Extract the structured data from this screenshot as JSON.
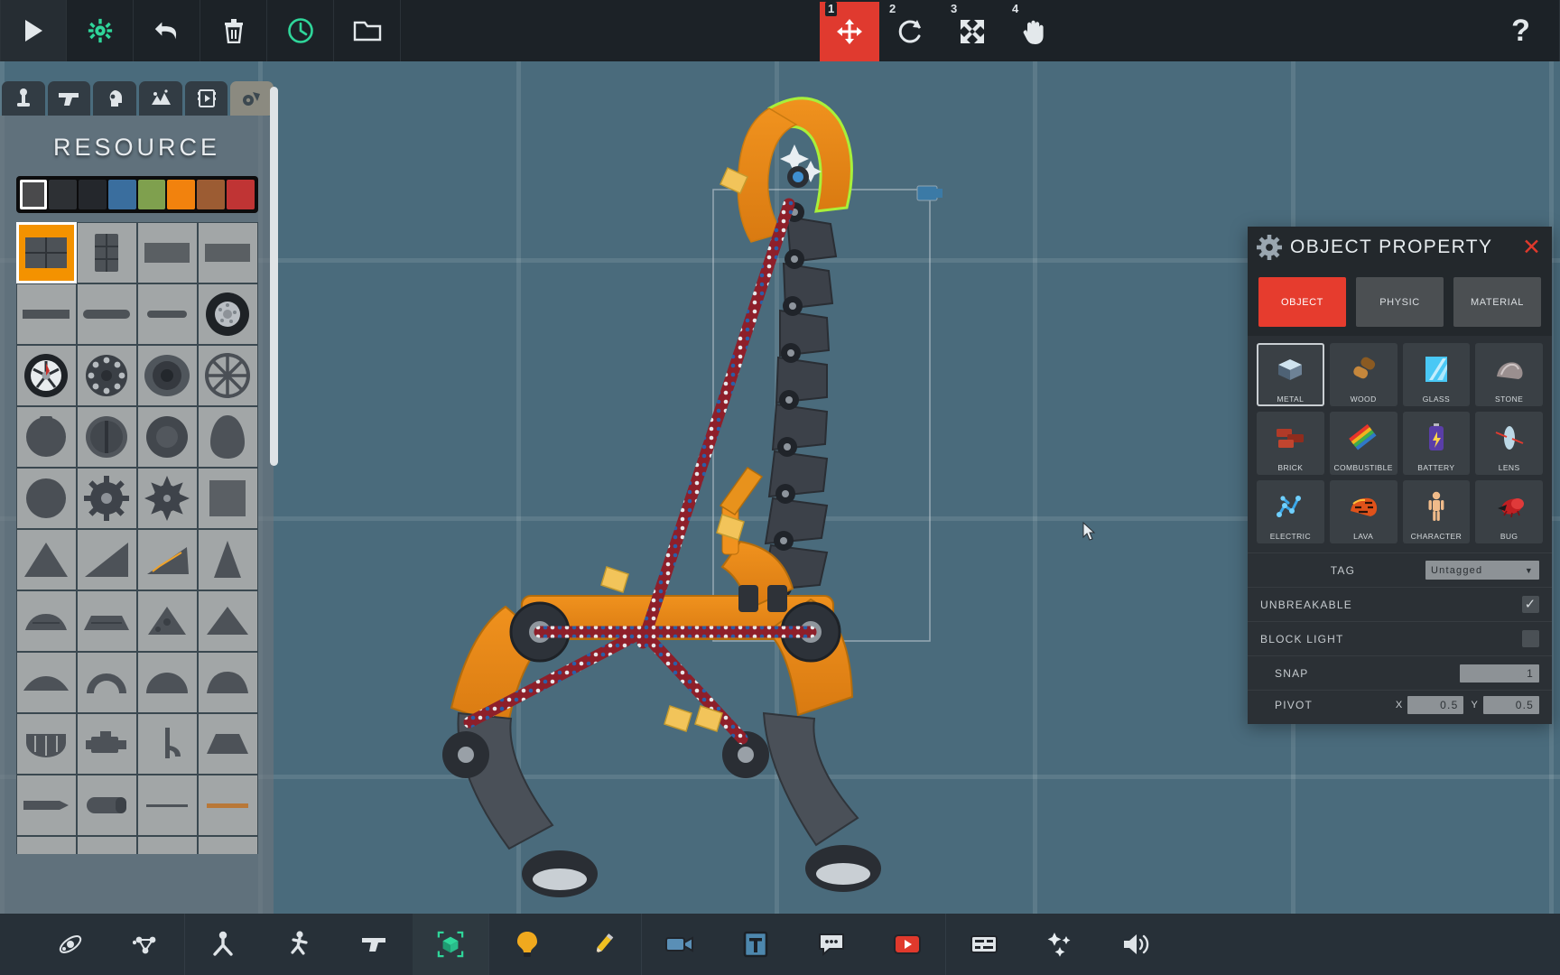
{
  "app": {
    "title": "Physics Sandbox Editor"
  },
  "topbar": {
    "left_buttons": [
      {
        "name": "play-button",
        "icon": "play-icon",
        "label": "Play",
        "color": "#e3e8eb"
      },
      {
        "name": "settings-button",
        "icon": "gear-icon",
        "label": "Settings",
        "color": "#2fd69a"
      },
      {
        "name": "undo-button",
        "icon": "undo-icon",
        "label": "Undo",
        "color": "#e3e8eb"
      },
      {
        "name": "delete-button",
        "icon": "trash-icon",
        "label": "Delete",
        "color": "#e3e8eb"
      },
      {
        "name": "history-button",
        "icon": "clock-icon",
        "label": "History",
        "color": "#2fd69a"
      },
      {
        "name": "open-button",
        "icon": "folder-icon",
        "label": "Open",
        "color": "#e3e8eb"
      }
    ],
    "tools": [
      {
        "name": "tool-move",
        "num": "1",
        "icon": "move-arrows-icon",
        "label": "Move",
        "active": true
      },
      {
        "name": "tool-rotate",
        "num": "2",
        "icon": "rotate-icon",
        "label": "Rotate",
        "active": false
      },
      {
        "name": "tool-scale",
        "num": "3",
        "icon": "expand-icon",
        "label": "Scale",
        "active": false
      },
      {
        "name": "tool-pan",
        "num": "4",
        "icon": "hand-icon",
        "label": "Pan",
        "active": false
      }
    ],
    "help": {
      "name": "help-button",
      "label": "?"
    },
    "active_tool_color": "#e03a2f"
  },
  "resource_panel": {
    "title": "RESOURCE",
    "tabs": [
      {
        "name": "tab-joints",
        "icon": "joint-icon",
        "active": false
      },
      {
        "name": "tab-weapons",
        "icon": "gun-icon",
        "active": false
      },
      {
        "name": "tab-heads",
        "icon": "head-icon",
        "active": false
      },
      {
        "name": "tab-terrain",
        "icon": "rocks-icon",
        "active": false
      },
      {
        "name": "tab-media",
        "icon": "film-icon",
        "active": false
      },
      {
        "name": "tab-vehicles",
        "icon": "vehicle-icon",
        "active": true
      }
    ],
    "palette": [
      {
        "name": "swatch-gray",
        "hex": "#4a4a4c",
        "selected": true
      },
      {
        "name": "swatch-dark",
        "hex": "#2d3034",
        "selected": false
      },
      {
        "name": "swatch-black",
        "hex": "#24272c",
        "selected": false
      },
      {
        "name": "swatch-blue",
        "hex": "#3a6e9e",
        "selected": false
      },
      {
        "name": "swatch-green",
        "hex": "#7fa04e",
        "selected": false
      },
      {
        "name": "swatch-orange",
        "hex": "#f2820d",
        "selected": false
      },
      {
        "name": "swatch-brown",
        "hex": "#9c5c33",
        "selected": false
      },
      {
        "name": "swatch-red",
        "hex": "#c03434",
        "selected": false
      }
    ],
    "parts": [
      {
        "name": "part-crate",
        "shape": "crate",
        "selected": true
      },
      {
        "name": "part-barrel",
        "shape": "barrel",
        "selected": false
      },
      {
        "name": "part-plate-l",
        "shape": "plate",
        "selected": false
      },
      {
        "name": "part-plate-s",
        "shape": "plate2",
        "selected": false
      },
      {
        "name": "part-bar",
        "shape": "bar",
        "selected": false
      },
      {
        "name": "part-rod",
        "shape": "rod",
        "selected": false
      },
      {
        "name": "part-rod-thin",
        "shape": "rodthin",
        "selected": false
      },
      {
        "name": "part-tire-rim",
        "shape": "tirechrome",
        "selected": false
      },
      {
        "name": "part-wheel-alloy",
        "shape": "alloy",
        "selected": false
      },
      {
        "name": "part-wheel-bolt",
        "shape": "bolt",
        "selected": false
      },
      {
        "name": "part-tire-solid",
        "shape": "tiresolid",
        "selected": false
      },
      {
        "name": "part-spoke",
        "shape": "spoke",
        "selected": false
      },
      {
        "name": "part-disc",
        "shape": "disc",
        "selected": false
      },
      {
        "name": "part-pulley",
        "shape": "pulley",
        "selected": false
      },
      {
        "name": "part-roller",
        "shape": "roller",
        "selected": false
      },
      {
        "name": "part-egg",
        "shape": "egg",
        "selected": false
      },
      {
        "name": "part-ball",
        "shape": "ball",
        "selected": false
      },
      {
        "name": "part-gear",
        "shape": "gear",
        "selected": false
      },
      {
        "name": "part-sawblade",
        "shape": "saw",
        "selected": false
      },
      {
        "name": "part-square",
        "shape": "square",
        "selected": false
      },
      {
        "name": "part-wedge",
        "shape": "wedge",
        "selected": false
      },
      {
        "name": "part-ramp",
        "shape": "ramp",
        "selected": false
      },
      {
        "name": "part-stairs",
        "shape": "stairs",
        "selected": false
      },
      {
        "name": "part-cone",
        "shape": "cone",
        "selected": false
      },
      {
        "name": "part-hull",
        "shape": "hull",
        "selected": false
      },
      {
        "name": "part-hull2",
        "shape": "hull2",
        "selected": false
      },
      {
        "name": "part-tri",
        "shape": "tri",
        "selected": false
      },
      {
        "name": "part-tri2",
        "shape": "tri2",
        "selected": false
      },
      {
        "name": "part-slab",
        "shape": "slab",
        "selected": false
      },
      {
        "name": "part-arch",
        "shape": "arch",
        "selected": false
      },
      {
        "name": "part-dome",
        "shape": "dome",
        "selected": false
      },
      {
        "name": "part-shell",
        "shape": "shell",
        "selected": false
      },
      {
        "name": "part-cage",
        "shape": "cage",
        "selected": false
      },
      {
        "name": "part-engine",
        "shape": "engine",
        "selected": false
      },
      {
        "name": "part-hook",
        "shape": "hook",
        "selected": false
      },
      {
        "name": "part-cap",
        "shape": "cap",
        "selected": false
      },
      {
        "name": "part-beam",
        "shape": "beam",
        "selected": false
      },
      {
        "name": "part-cylinder",
        "shape": "cyl",
        "selected": false
      },
      {
        "name": "part-line",
        "shape": "line",
        "selected": false
      },
      {
        "name": "part-strip",
        "shape": "strip",
        "selected": false
      },
      {
        "name": "part-blank-a",
        "shape": "blank",
        "selected": false
      },
      {
        "name": "part-blank-b",
        "shape": "blank",
        "selected": false
      },
      {
        "name": "part-blank-c",
        "shape": "blank",
        "selected": false
      },
      {
        "name": "part-blank-d",
        "shape": "blank",
        "selected": false
      }
    ]
  },
  "object_property": {
    "title": "OBJECT PROPERTY",
    "close_label": "✕",
    "tabs": [
      {
        "name": "tab-object",
        "label": "OBJECT",
        "active": true
      },
      {
        "name": "tab-physic",
        "label": "PHYSIC",
        "active": false
      },
      {
        "name": "tab-material",
        "label": "MATERIAL",
        "active": false
      }
    ],
    "materials": [
      {
        "name": "material-metal",
        "label": "METAL",
        "icon": "metal-block-icon",
        "selected": true
      },
      {
        "name": "material-wood",
        "label": "WOOD",
        "icon": "wood-log-icon",
        "selected": false
      },
      {
        "name": "material-glass",
        "label": "GLASS",
        "icon": "glass-pane-icon",
        "selected": false
      },
      {
        "name": "material-stone",
        "label": "STONE",
        "icon": "stone-rock-icon",
        "selected": false
      },
      {
        "name": "material-brick",
        "label": "BRICK",
        "icon": "brick-icon",
        "selected": false
      },
      {
        "name": "material-combustible",
        "label": "COMBUSTIBLE",
        "icon": "match-sticks-icon",
        "selected": false
      },
      {
        "name": "material-battery",
        "label": "BATTERY",
        "icon": "battery-icon",
        "selected": false
      },
      {
        "name": "material-lens",
        "label": "LENS",
        "icon": "lens-icon",
        "selected": false
      },
      {
        "name": "material-electric",
        "label": "ELECTRIC",
        "icon": "electric-icon",
        "selected": false
      },
      {
        "name": "material-lava",
        "label": "LAVA",
        "icon": "lava-icon",
        "selected": false
      },
      {
        "name": "material-character",
        "label": "CHARACTER",
        "icon": "character-icon",
        "selected": false
      },
      {
        "name": "material-bug",
        "label": "BUG",
        "icon": "bug-icon",
        "selected": false
      }
    ],
    "tag": {
      "label": "TAG",
      "value": "Untagged"
    },
    "unbreakable": {
      "label": "UNBREAKABLE",
      "checked": true,
      "tick": "✓"
    },
    "block_light": {
      "label": "BLOCK LIGHT",
      "checked": false
    },
    "snap": {
      "label": "SNAP",
      "value": "1"
    },
    "pivot": {
      "label": "PIVOT",
      "x_label": "X",
      "x_value": "0.5",
      "y_label": "Y",
      "y_value": "0.5"
    }
  },
  "bottombar": {
    "groups": [
      [
        {
          "name": "physics-button",
          "icon": "atom-icon",
          "label": "Physics"
        },
        {
          "name": "network-button",
          "icon": "nodes-icon",
          "label": "Connections"
        }
      ],
      [
        {
          "name": "joint-button",
          "icon": "joint-icon",
          "label": "Joint"
        },
        {
          "name": "ragdoll-button",
          "icon": "person-icon",
          "label": "Ragdoll"
        },
        {
          "name": "weapon-button",
          "icon": "gun-icon",
          "label": "Weapon"
        },
        {
          "name": "object-button",
          "icon": "cube-icon",
          "label": "Object",
          "accent": "#2fd69a"
        }
      ],
      [
        {
          "name": "light-button",
          "icon": "bulb-icon",
          "label": "Light"
        },
        {
          "name": "draw-button",
          "icon": "pencil-icon",
          "label": "Draw"
        }
      ],
      [
        {
          "name": "camera-button",
          "icon": "camcorder-icon",
          "label": "Camera"
        },
        {
          "name": "text-button",
          "icon": "text-icon",
          "label": "Text"
        },
        {
          "name": "dialogue-button",
          "icon": "speech-icon",
          "label": "Dialogue"
        },
        {
          "name": "video-button",
          "icon": "video-icon",
          "label": "Video"
        }
      ],
      [
        {
          "name": "ui-button",
          "icon": "panel-icon",
          "label": "UI"
        },
        {
          "name": "particle-button",
          "icon": "sparkles-icon",
          "label": "Particles"
        },
        {
          "name": "sound-button",
          "icon": "speaker-icon",
          "label": "Sound"
        }
      ]
    ]
  },
  "canvas": {
    "selection": {
      "outline_color": "#a8f03a",
      "label": "selected-object"
    },
    "grid_color": "#5d7e91",
    "background": "#4e6e81"
  }
}
